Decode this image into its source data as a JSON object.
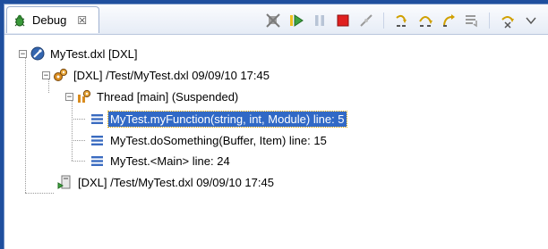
{
  "tab": {
    "label": "Debug",
    "close": "☒"
  },
  "toolbar": {
    "buttons": [
      "remove-terminated-icon",
      "resume-icon",
      "suspend-icon",
      "terminate-icon",
      "disconnect-icon",
      "step-into-icon",
      "step-over-icon",
      "step-return-icon",
      "drop-to-frame-icon",
      "use-step-filters-icon",
      "view-menu-icon"
    ]
  },
  "tree": {
    "launch": "MyTest.dxl [DXL]",
    "target": "[DXL] /Test/MyTest.dxl 09/09/10 17:45",
    "thread": "Thread [main] (Suspended)",
    "frames": [
      "MyTest.myFunction(string, int, Module) line: 5",
      "MyTest.doSomething(Buffer, Item) line: 15",
      "MyTest.<Main> line: 24"
    ],
    "process": "[DXL] /Test/MyTest.dxl 09/09/10 17:45",
    "expand_minus": "−"
  }
}
